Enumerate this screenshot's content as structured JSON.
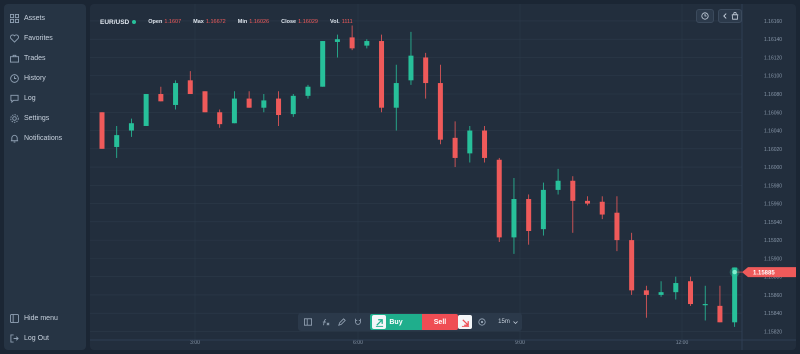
{
  "sidebar": {
    "items": [
      {
        "label": "Assets",
        "icon": "grid-icon"
      },
      {
        "label": "Favorites",
        "icon": "heart-icon"
      },
      {
        "label": "Trades",
        "icon": "briefcase-icon"
      },
      {
        "label": "History",
        "icon": "clock-icon"
      },
      {
        "label": "Log",
        "icon": "chat-icon"
      },
      {
        "label": "Settings",
        "icon": "gear-icon"
      },
      {
        "label": "Notifications",
        "icon": "bell-icon"
      }
    ],
    "bottom": [
      {
        "label": "Hide menu",
        "icon": "panel-icon"
      },
      {
        "label": "Log Out",
        "icon": "logout-icon"
      }
    ]
  },
  "header": {
    "symbol": "EUR/USD",
    "open_label": "Open",
    "open_value": "1.1607",
    "max_label": "Max",
    "max_value": "1.16672",
    "min_label": "Min",
    "min_value": "1.16026",
    "close_label": "Close",
    "close_value": "1.16029",
    "vol_label": "Vol.",
    "vol_value": "1111"
  },
  "toolbar": {
    "buy_label": "Buy",
    "sell_label": "Sell",
    "timeframe": "15m"
  },
  "colors": {
    "up": "#27c09a",
    "down": "#ef5a5a",
    "background": "#222e3d",
    "grid": "#2c3a4a"
  },
  "chart_data": {
    "type": "candlestick",
    "x_ticks": [
      "3:00",
      "6:00",
      "9:00",
      "12:00"
    ],
    "y_ticks": [
      "1.16160",
      "1.16140",
      "1.16120",
      "1.16100",
      "1.16080",
      "1.16060",
      "1.16040",
      "1.16020",
      "1.16000",
      "1.15980",
      "1.15960",
      "1.15940",
      "1.15920",
      "1.15900",
      "1.15880",
      "1.15860",
      "1.15840",
      "1.15820"
    ],
    "ylim": [
      1.15815,
      1.16172
    ],
    "current_price": "1.15885",
    "candles": [
      {
        "o": 1.1606,
        "h": 1.1606,
        "l": 1.1602,
        "c": 1.1602
      },
      {
        "o": 1.16022,
        "h": 1.16045,
        "l": 1.1601,
        "c": 1.16035
      },
      {
        "o": 1.1604,
        "h": 1.16053,
        "l": 1.16033,
        "c": 1.16048
      },
      {
        "o": 1.16045,
        "h": 1.1608,
        "l": 1.16045,
        "c": 1.1608
      },
      {
        "o": 1.1608,
        "h": 1.16088,
        "l": 1.16072,
        "c": 1.16072
      },
      {
        "o": 1.16068,
        "h": 1.16095,
        "l": 1.16063,
        "c": 1.16092
      },
      {
        "o": 1.16095,
        "h": 1.16105,
        "l": 1.1608,
        "c": 1.1608
      },
      {
        "o": 1.16083,
        "h": 1.16083,
        "l": 1.1606,
        "c": 1.1606
      },
      {
        "o": 1.1606,
        "h": 1.16063,
        "l": 1.16043,
        "c": 1.16047
      },
      {
        "o": 1.16048,
        "h": 1.16083,
        "l": 1.16048,
        "c": 1.16075
      },
      {
        "o": 1.16075,
        "h": 1.16083,
        "l": 1.16065,
        "c": 1.16065
      },
      {
        "o": 1.16065,
        "h": 1.1608,
        "l": 1.1606,
        "c": 1.16073
      },
      {
        "o": 1.16075,
        "h": 1.16083,
        "l": 1.16045,
        "c": 1.16057
      },
      {
        "o": 1.16058,
        "h": 1.1608,
        "l": 1.16055,
        "c": 1.16078
      },
      {
        "o": 1.16078,
        "h": 1.1609,
        "l": 1.16075,
        "c": 1.16088
      },
      {
        "o": 1.16088,
        "h": 1.16138,
        "l": 1.16088,
        "c": 1.16138
      },
      {
        "o": 1.16137,
        "h": 1.16145,
        "l": 1.1612,
        "c": 1.1614
      },
      {
        "o": 1.16142,
        "h": 1.16155,
        "l": 1.16128,
        "c": 1.1613
      },
      {
        "o": 1.16133,
        "h": 1.1614,
        "l": 1.1613,
        "c": 1.16138
      },
      {
        "o": 1.16138,
        "h": 1.16145,
        "l": 1.1606,
        "c": 1.16065
      },
      {
        "o": 1.16065,
        "h": 1.16112,
        "l": 1.1604,
        "c": 1.16092
      },
      {
        "o": 1.16095,
        "h": 1.16148,
        "l": 1.1609,
        "c": 1.16122
      },
      {
        "o": 1.1612,
        "h": 1.16125,
        "l": 1.16075,
        "c": 1.16092
      },
      {
        "o": 1.16092,
        "h": 1.16112,
        "l": 1.16025,
        "c": 1.1603
      },
      {
        "o": 1.16032,
        "h": 1.1605,
        "l": 1.16,
        "c": 1.1601
      },
      {
        "o": 1.16015,
        "h": 1.16045,
        "l": 1.16005,
        "c": 1.1604
      },
      {
        "o": 1.1604,
        "h": 1.16045,
        "l": 1.16005,
        "c": 1.1601
      },
      {
        "o": 1.16008,
        "h": 1.1601,
        "l": 1.15918,
        "c": 1.15923
      },
      {
        "o": 1.15923,
        "h": 1.15988,
        "l": 1.15905,
        "c": 1.15965
      },
      {
        "o": 1.15965,
        "h": 1.1597,
        "l": 1.15915,
        "c": 1.1593
      },
      {
        "o": 1.15932,
        "h": 1.15983,
        "l": 1.15925,
        "c": 1.15975
      },
      {
        "o": 1.15975,
        "h": 1.15998,
        "l": 1.1597,
        "c": 1.15985
      },
      {
        "o": 1.15985,
        "h": 1.1599,
        "l": 1.15928,
        "c": 1.15963
      },
      {
        "o": 1.15963,
        "h": 1.15968,
        "l": 1.15958,
        "c": 1.1596
      },
      {
        "o": 1.15962,
        "h": 1.15968,
        "l": 1.15943,
        "c": 1.15948
      },
      {
        "o": 1.1595,
        "h": 1.15968,
        "l": 1.15908,
        "c": 1.1592
      },
      {
        "o": 1.1592,
        "h": 1.15928,
        "l": 1.1586,
        "c": 1.15865
      },
      {
        "o": 1.15865,
        "h": 1.1587,
        "l": 1.15835,
        "c": 1.1586
      },
      {
        "o": 1.1586,
        "h": 1.15875,
        "l": 1.15858,
        "c": 1.15863
      },
      {
        "o": 1.15863,
        "h": 1.1588,
        "l": 1.15855,
        "c": 1.15873
      },
      {
        "o": 1.15875,
        "h": 1.1588,
        "l": 1.15848,
        "c": 1.1585
      },
      {
        "o": 1.1585,
        "h": 1.1587,
        "l": 1.15832,
        "c": 1.1585
      },
      {
        "o": 1.15848,
        "h": 1.1587,
        "l": 1.1583,
        "c": 1.1583
      },
      {
        "o": 1.1583,
        "h": 1.1589,
        "l": 1.15825,
        "c": 1.1589
      }
    ]
  }
}
